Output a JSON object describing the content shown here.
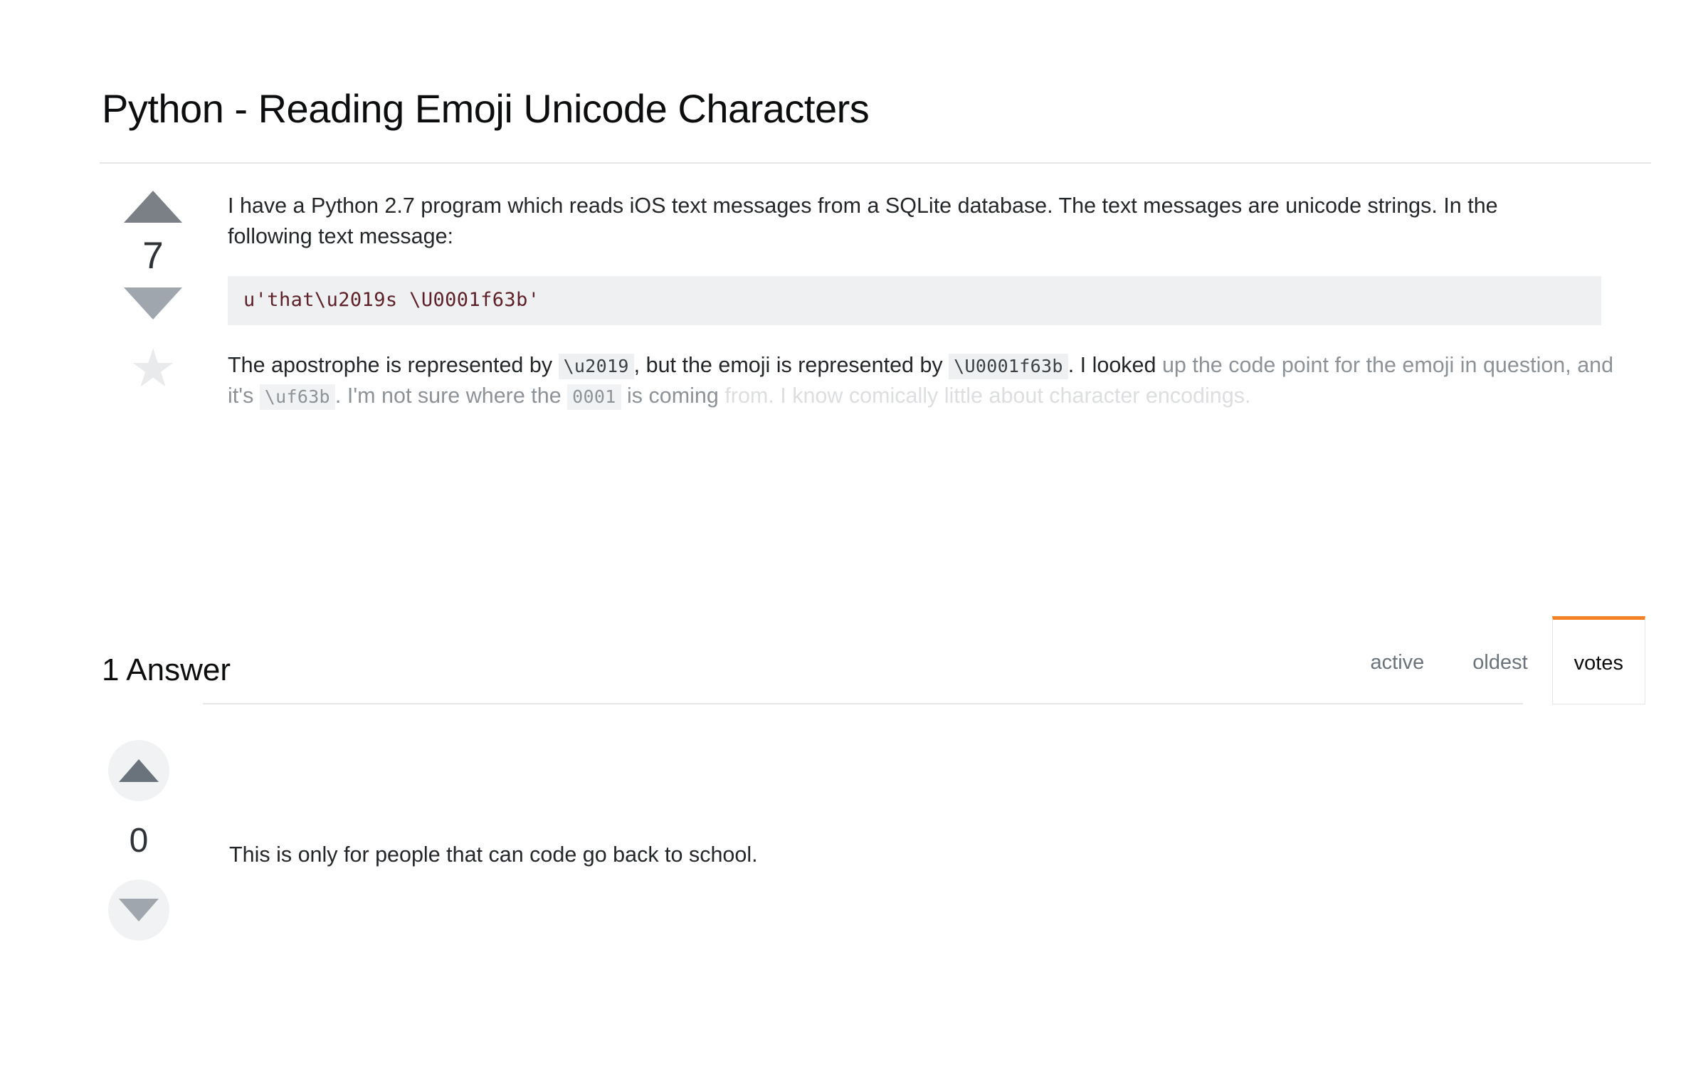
{
  "question": {
    "title": "Python - Reading Emoji Unicode Characters",
    "vote_count": "7",
    "upvote_icon": "triangle-up-icon",
    "downvote_icon": "triangle-down-icon",
    "favorite_icon": "star-icon",
    "paragraph_1": "I have a Python 2.7 program which reads iOS text messages from a SQLite database. The text messages are unicode strings. In the following text message:",
    "code_block": "u'that\\u2019s \\U0001f63b'",
    "body_line_1_a": "The apostrophe is represented by ",
    "body_code_1": "\\u2019",
    "body_line_1_b": ", but the emoji is represented by ",
    "body_code_2": "\\U0001f63b",
    "body_line_1_c": ". I looked",
    "body_line_2_a": "up the code point for the emoji in question, and it's ",
    "body_code_3": "\\uf63b",
    "body_line_2_b": ". I'm not sure where the ",
    "body_code_4": "0001",
    "body_line_2_c": " is coming",
    "body_line_3": "from. I know comically little about character encodings."
  },
  "answers_section": {
    "heading": "1 Answer",
    "tabs": [
      {
        "label": "active",
        "selected": false
      },
      {
        "label": "oldest",
        "selected": false
      },
      {
        "label": "votes",
        "selected": true
      }
    ],
    "accent_color": "#f48024"
  },
  "answer": {
    "vote_count": "0",
    "upvote_icon": "triangle-up-icon",
    "downvote_icon": "triangle-down-icon",
    "text": "This is only for people that can code go back to school."
  }
}
